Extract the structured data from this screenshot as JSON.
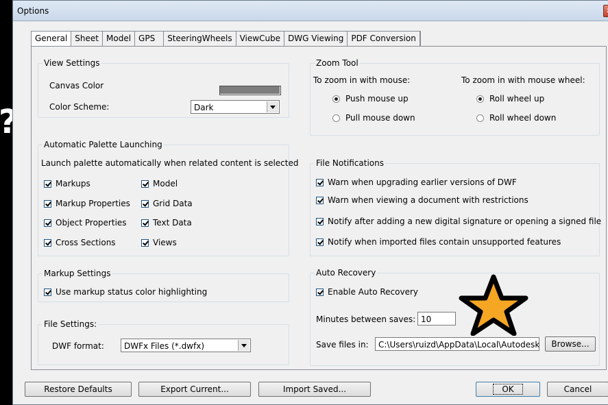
{
  "window": {
    "title": "Options",
    "close_label": "x"
  },
  "background_glyph": "?",
  "tabs": [
    "General",
    "Sheet",
    "Model",
    "GPS",
    "SteeringWheels",
    "ViewCube",
    "DWG Viewing",
    "PDF Conversion"
  ],
  "view_settings": {
    "title": "View Settings",
    "canvas_color_label": "Canvas Color",
    "canvas_color": "#7d7d7d",
    "color_scheme_label": "Color Scheme:",
    "color_scheme_value": "Dark"
  },
  "zoom_tool": {
    "title": "Zoom Tool",
    "mouse_label": "To zoom in with mouse:",
    "wheel_label": "To zoom in with mouse wheel:",
    "mouse_options": [
      "Push mouse up",
      "Pull mouse down"
    ],
    "mouse_selected": "Push mouse up",
    "wheel_options": [
      "Roll wheel up",
      "Roll wheel down"
    ],
    "wheel_selected": "Roll wheel up"
  },
  "palette": {
    "title": "Automatic Palette Launching",
    "description": "Launch palette automatically when related content is selected",
    "items": [
      {
        "label": "Markups",
        "checked": true
      },
      {
        "label": "Model",
        "checked": true
      },
      {
        "label": "Markup Properties",
        "checked": true
      },
      {
        "label": "Grid Data",
        "checked": true
      },
      {
        "label": "Object Properties",
        "checked": true
      },
      {
        "label": "Text Data",
        "checked": true
      },
      {
        "label": "Cross Sections",
        "checked": true
      },
      {
        "label": "Views",
        "checked": true
      }
    ]
  },
  "file_notifications": {
    "title": "File Notifications",
    "items": [
      {
        "label": "Warn when upgrading earlier versions of DWF",
        "checked": true
      },
      {
        "label": "Warn when viewing a document with restrictions",
        "checked": true
      },
      {
        "label": "Notify after adding a new digital signature or opening a signed file",
        "checked": true
      },
      {
        "label": "Notify when imported files contain unsupported features",
        "checked": true
      }
    ]
  },
  "markup_settings": {
    "title": "Markup Settings",
    "item": {
      "label": "Use markup status color highlighting",
      "checked": true
    }
  },
  "auto_recovery": {
    "title": "Auto Recovery",
    "enable_label": "Enable Auto Recovery",
    "enabled": true,
    "minutes_label": "Minutes between saves:",
    "minutes_value": "10",
    "save_in_label": "Save files in:",
    "save_in_value": "C:\\Users\\ruizd\\AppData\\Local\\Autodesk\\",
    "browse_label": "Browse..."
  },
  "file_settings": {
    "title": "File Settings:",
    "dwf_format_label": "DWF format:",
    "dwf_format_value": "DWFx Files (*.dwfx)"
  },
  "buttons": {
    "restore": "Restore Defaults",
    "export": "Export Current...",
    "import": "Import Saved...",
    "ok": "OK",
    "cancel": "Cancel"
  },
  "annotation_star": {
    "fill": "#f5a623",
    "stroke": "#000000"
  }
}
